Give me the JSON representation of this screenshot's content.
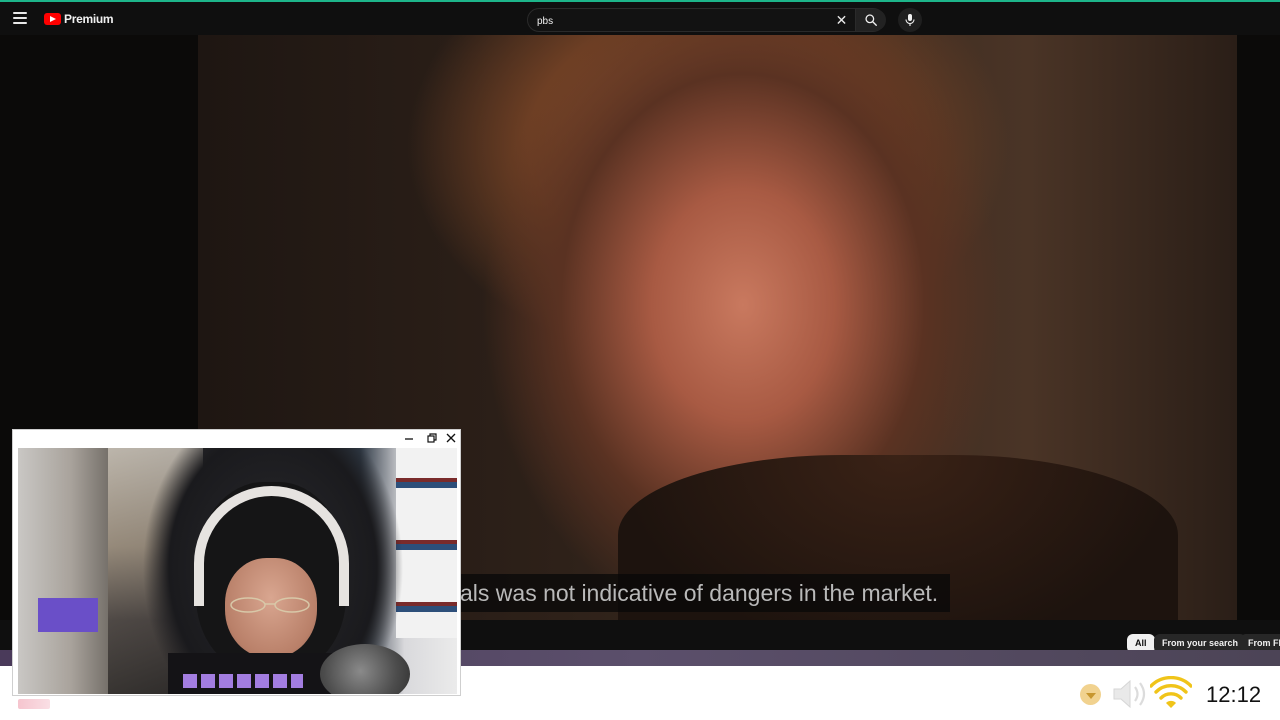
{
  "header": {
    "brand_label": "Premium",
    "search": {
      "value": "pbs",
      "placeholder": "Search"
    }
  },
  "video": {
    "caption": "als was not indicative of dangers in the market."
  },
  "chips": [
    {
      "label": "All",
      "active": true
    },
    {
      "label": "From your search",
      "active": false
    },
    {
      "label": "From FR",
      "active": false
    }
  ],
  "taskbar": {
    "clock": "12:12"
  },
  "webcam_window": {
    "controls": [
      "minimize",
      "restore",
      "close"
    ]
  },
  "colors": {
    "accent_top_border": "#1db58a",
    "youtube_red": "#ff0000",
    "taskbar_bg": "#ffffff",
    "wifi_yellow": "#f0c419"
  },
  "icons": [
    "menu-icon",
    "youtube-logo-icon",
    "clear-icon",
    "search-icon",
    "mic-icon",
    "minimize-icon",
    "restore-icon",
    "close-icon",
    "tray-chevron-icon",
    "volume-muted-icon",
    "wifi-icon"
  ]
}
